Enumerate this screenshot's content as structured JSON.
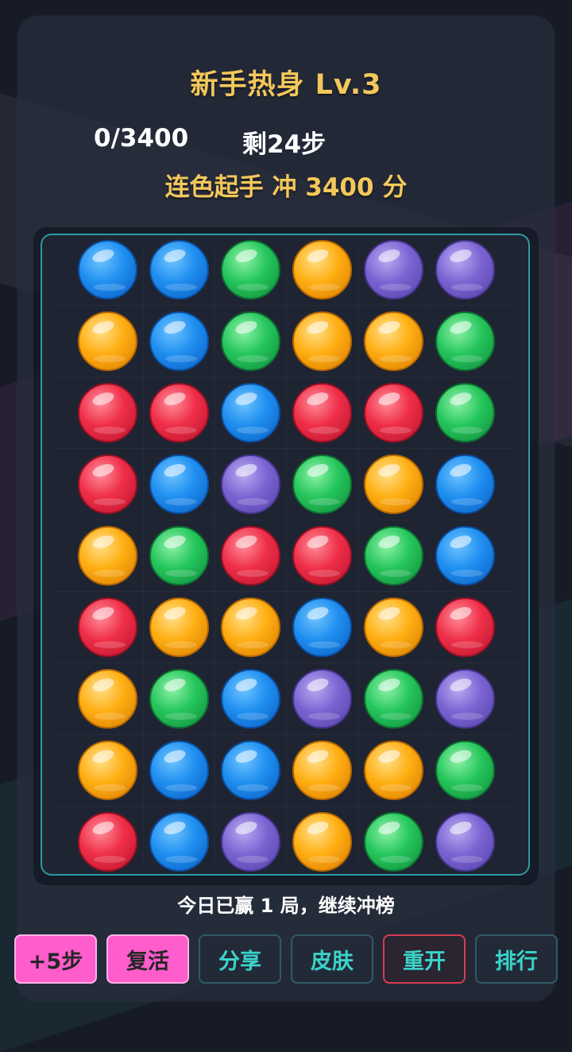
{
  "header": {
    "title": "新手热身  Lv.3",
    "score": "0/3400",
    "steps": "剩24步",
    "goal": "连色起手  冲 3400 分"
  },
  "colors": {
    "blue": "#1f8ff0",
    "green": "#25c65c",
    "orange": "#ffae12",
    "purple": "#7b64d2",
    "red": "#ef2e48",
    "gold_text": "#f3c85b",
    "board_border": "#2c9aa0",
    "button_pink": "#ff5ccc",
    "button_teal_text": "#3bd3c9"
  },
  "board": {
    "rows": [
      [
        "blue",
        "blue",
        "green",
        "orange",
        "purple",
        "purple"
      ],
      [
        "orange",
        "blue",
        "green",
        "orange",
        "orange",
        "green"
      ],
      [
        "red",
        "red",
        "blue",
        "red",
        "red",
        "green"
      ],
      [
        "red",
        "blue",
        "purple",
        "green",
        "orange",
        "blue"
      ],
      [
        "orange",
        "green",
        "red",
        "red",
        "green",
        "blue"
      ],
      [
        "red",
        "orange",
        "orange",
        "blue",
        "orange",
        "red"
      ],
      [
        "orange",
        "green",
        "blue",
        "purple",
        "green",
        "purple"
      ],
      [
        "orange",
        "blue",
        "blue",
        "orange",
        "orange",
        "green"
      ],
      [
        "red",
        "blue",
        "purple",
        "orange",
        "green",
        "purple"
      ]
    ]
  },
  "status_text": "今日已赢 1 局，继续冲榜",
  "buttons": {
    "add_steps": "+5步",
    "revive": "复活",
    "share": "分享",
    "skin": "皮肤",
    "restart": "重开",
    "rank": "排行"
  }
}
